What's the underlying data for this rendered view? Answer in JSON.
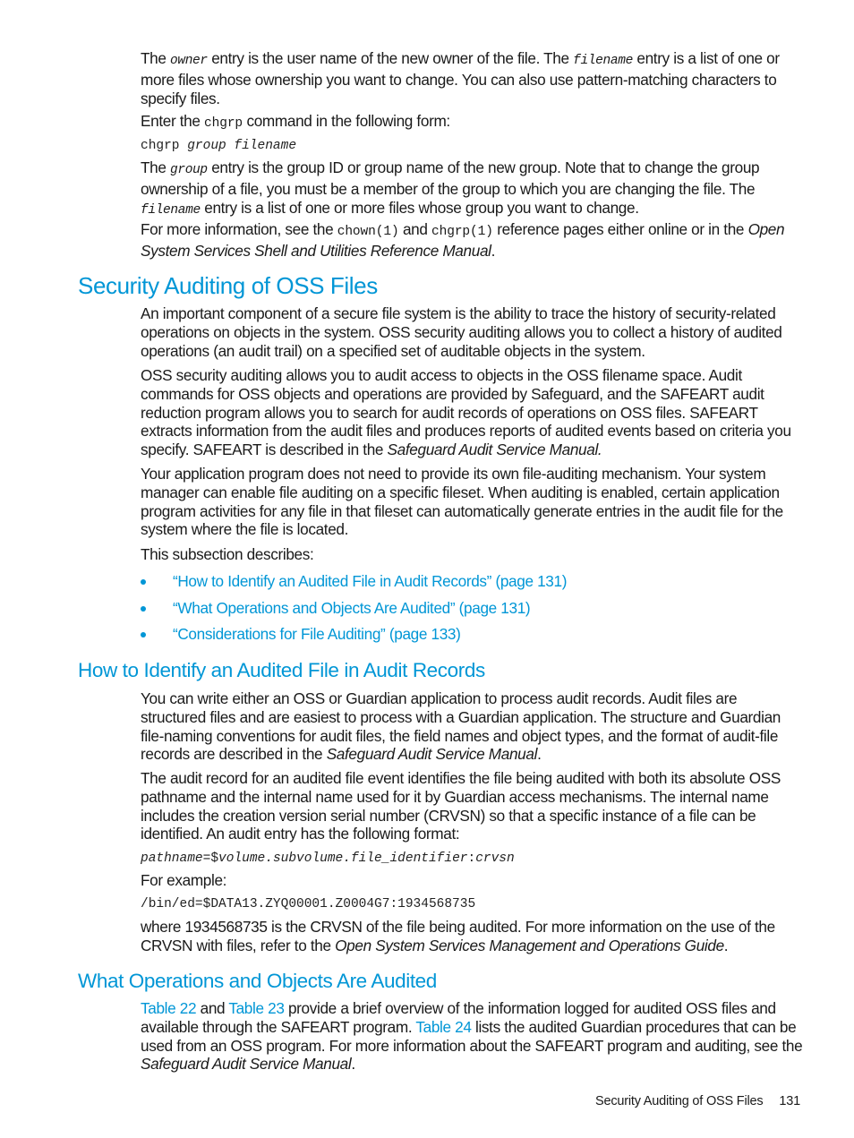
{
  "intro": {
    "p1": {
      "a": "The ",
      "owner": "owner",
      "b": " entry is the user name of the new owner of the file. The ",
      "filename": "filename",
      "c": " entry is a list of one or more files whose ownership you want to change. You can also use pattern-matching characters to specify files."
    },
    "p2": {
      "a": "Enter the ",
      "cmd": "chgrp",
      "b": " command in the following form:"
    },
    "syntax": {
      "cmd": "chgrp ",
      "args": "group filename"
    },
    "p3": {
      "a": "The ",
      "group": "group",
      "b": " entry is the group ID or group name of the new group. Note that to change the group ownership of a file, you must be a member of the group to which you are changing the file. The ",
      "filename": "filename",
      "c": " entry is a list of one or more files whose group you want to change."
    },
    "p4": {
      "a": "For more information, see the ",
      "ref1": "chown(1)",
      "b": " and ",
      "ref2": "chgrp(1)",
      "c": " reference pages either online or in the ",
      "manual": "Open System Services Shell and Utilities Reference Manual",
      "d": "."
    }
  },
  "section1": {
    "title": "Security Auditing of OSS Files",
    "p1": "An important component of a secure file system is the ability to trace the history of security-related operations on objects in the system. OSS security auditing allows you to collect a history of audited operations (an audit trail) on a specified set of auditable objects in the system.",
    "p2": {
      "a": "OSS security auditing allows you to audit access to objects in the OSS filename space. Audit commands for OSS objects and operations are provided by Safeguard, and the SAFEART audit reduction program allows you to search for audit records of operations on OSS files. SAFEART extracts information from the audit files and produces reports of audited events based on criteria you specify. SAFEART is described in the ",
      "manual": "Safeguard Audit Service Manual.",
      "b": ""
    },
    "p3": "Your application program does not need to provide its own file-auditing mechanism. Your system manager can enable file auditing on a specific fileset. When auditing is enabled, certain application program activities for any file in that fileset can automatically generate entries in the audit file for the system where the file is located.",
    "p4": "This subsection describes:",
    "bullets": [
      "“How to Identify an Audited File in Audit Records” (page 131)",
      "“What Operations and Objects Are Audited” (page 131)",
      "“Considerations for File Auditing” (page 133)"
    ]
  },
  "section2": {
    "title": "How to Identify an Audited File in Audit Records",
    "p1": {
      "a": "You can write either an OSS or Guardian application to process audit records. Audit files are structured files and are easiest to process with a Guardian application. The structure and Guardian file-naming conventions for audit files, the field names and object types, and the format of audit-file records are described in the ",
      "manual": "Safeguard Audit Service Manual",
      "b": "."
    },
    "p2": "The audit record for an audited file event identifies the file being audited with both its absolute OSS pathname and the internal name used for it by Guardian access mechanisms. The internal name includes the creation version serial number (CRVSN) so that a specific instance of a file can be identified. An audit entry has the following format:",
    "format": {
      "a": "pathname=",
      "b": "$",
      "c": "volume.subvolume.file_identifier",
      "d": ":",
      "e": "crvsn"
    },
    "p3": "For example:",
    "example": "/bin/ed=$DATA13.ZYQ00001.Z0004G7:1934568735",
    "p4": {
      "a": "where 1934568735 is the CRVSN of the file being audited. For more information on the use of the CRVSN with files, refer to the ",
      "manual": "Open System Services Management and Operations Guide",
      "b": "."
    }
  },
  "section3": {
    "title": "What Operations and Objects Are Audited",
    "p1": {
      "link1": "Table 22",
      "a": " and ",
      "link2": "Table 23",
      "b": " provide a brief overview of the information logged for audited OSS files and available through the SAFEART program. ",
      "link3": "Table 24",
      "c": " lists the audited Guardian procedures that can be used from an OSS program. For more information about the SAFEART program and auditing, see the ",
      "manual": "Safeguard Audit Service Manual",
      "d": "."
    }
  },
  "footer": {
    "section": "Security Auditing of OSS Files",
    "page": "131"
  },
  "colors": {
    "heading": "#0096d6",
    "link": "#0096d6",
    "text": "#1a1a1a"
  }
}
